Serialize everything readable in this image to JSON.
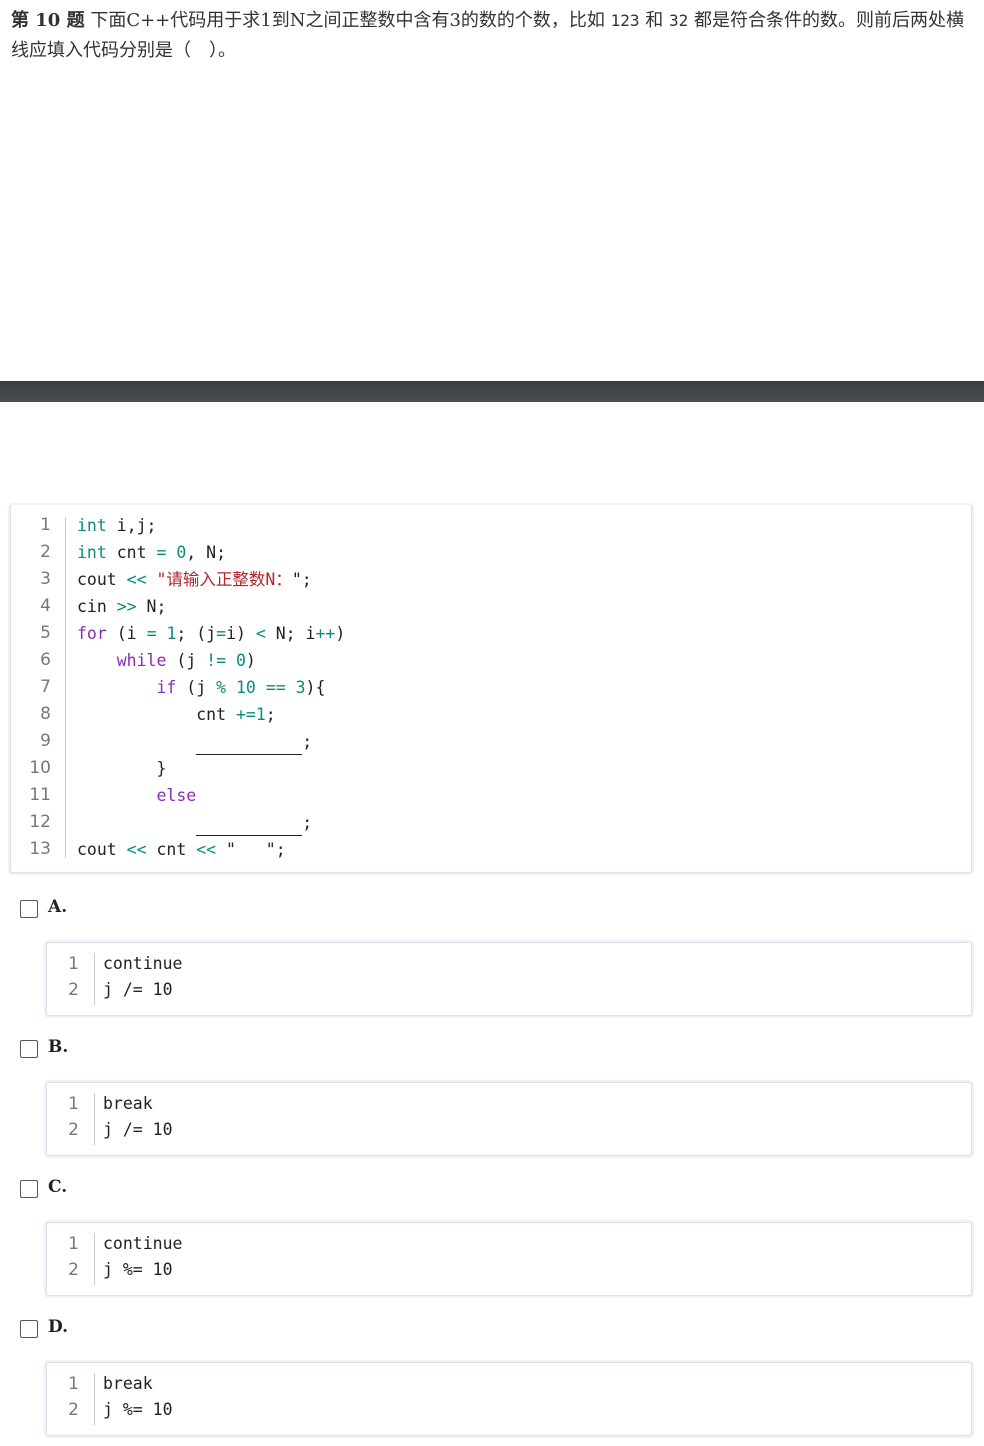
{
  "question": {
    "number": "第 10 题",
    "text_before": "下面C++代码用于求1到N之间正整数中含有3的数的个数，比如 ",
    "example1": "123",
    "text_and": " 和 ",
    "example2": "32",
    "text_after": " 都是符合条件的数。则前后两处横线应填入代码分别是（　）。"
  },
  "main_code": {
    "line_numbers": [
      "1",
      "2",
      "3",
      "4",
      "5",
      "6",
      "7",
      "8",
      "9",
      "10",
      "11",
      "12",
      "13"
    ],
    "l1_kw": "int",
    "l1_rest": " i,j;",
    "l2_kw": "int",
    "l2_a": " cnt ",
    "l2_op": "=",
    "l2_b": " ",
    "l2_num": "0",
    "l2_c": ", N;",
    "l3_a": "cout ",
    "l3_op": "<<",
    "l3_b": " ",
    "l3_str": "\"请输入正整数N：",
    "l3_c": "\";",
    "l4_a": "cin ",
    "l4_op": ">>",
    "l4_b": " N;",
    "l5_kw": "for",
    "l5_a": " (i ",
    "l5_op1": "=",
    "l5_b": " ",
    "l5_num": "1",
    "l5_c": "; (j",
    "l5_op2": "=",
    "l5_d": "i) ",
    "l5_op3": "<",
    "l5_e": " N; i",
    "l5_op4": "++",
    "l5_f": ")",
    "l6_indent": "    ",
    "l6_kw": "while",
    "l6_a": " (j ",
    "l6_op": "!=",
    "l6_b": " ",
    "l6_num": "0",
    "l6_c": ")",
    "l7_indent": "        ",
    "l7_kw": "if",
    "l7_a": " (j ",
    "l7_op1": "%",
    "l7_b": " ",
    "l7_num1": "10",
    "l7_c": " ",
    "l7_op2": "==",
    "l7_d": " ",
    "l7_num2": "3",
    "l7_e": "){",
    "l8_indent": "            ",
    "l8_a": "cnt ",
    "l8_op": "+=",
    "l8_num": "1",
    "l8_b": ";",
    "l9_indent": "            ",
    "l9_end": ";",
    "l10_indent": "        ",
    "l10_a": "}",
    "l11_indent": "        ",
    "l11_kw": "else",
    "l12_indent": "            ",
    "l12_end": ";",
    "l13_a": "cout ",
    "l13_op1": "<<",
    "l13_b": " cnt ",
    "l13_op2": "<<",
    "l13_c": " \"   \";"
  },
  "options": [
    {
      "label": "A.",
      "line_numbers": [
        "1",
        "2"
      ],
      "lines": [
        "continue",
        "j /= 10"
      ]
    },
    {
      "label": "B.",
      "line_numbers": [
        "1",
        "2"
      ],
      "lines": [
        "break",
        "j /= 10"
      ]
    },
    {
      "label": "C.",
      "line_numbers": [
        "1",
        "2"
      ],
      "lines": [
        "continue",
        "j %= 10"
      ]
    },
    {
      "label": "D.",
      "line_numbers": [
        "1",
        "2"
      ],
      "lines": [
        "break",
        "j %= 10"
      ]
    }
  ]
}
